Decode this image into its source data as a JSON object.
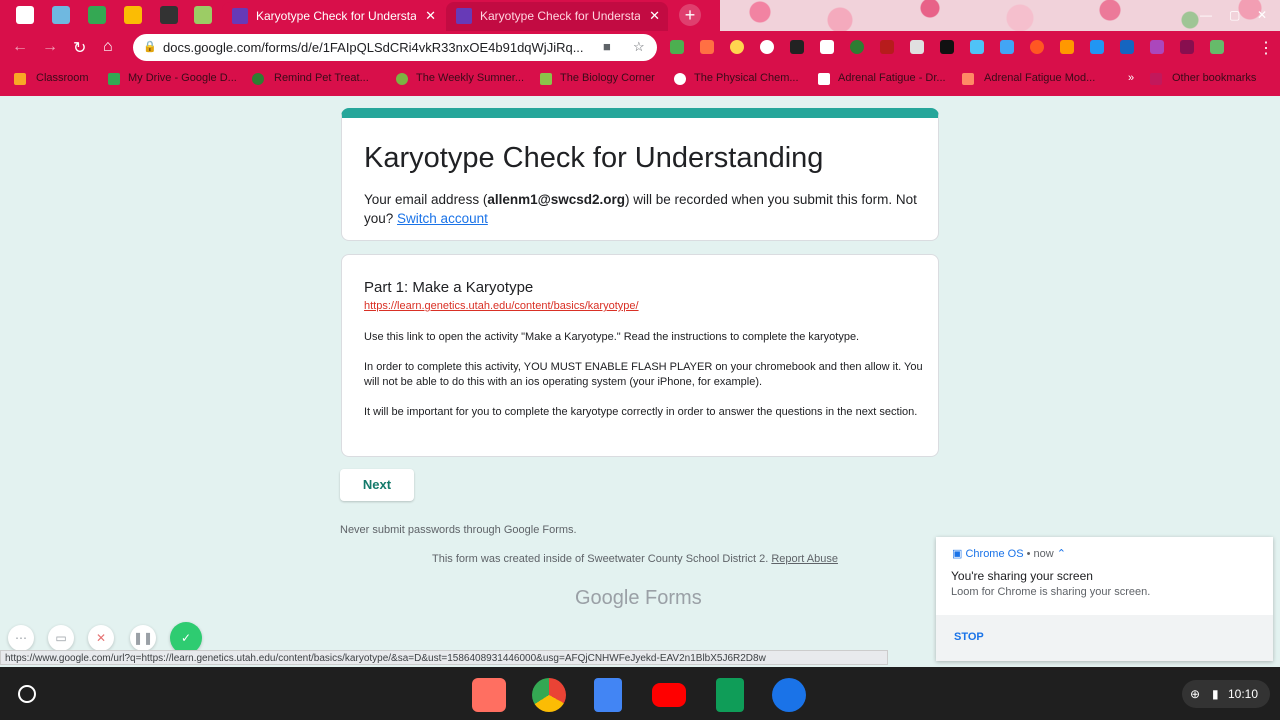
{
  "browser": {
    "active_tab_title": "Karyotype Check for Understanding",
    "second_tab_title": "Karyotype Check for Understanding",
    "url": "docs.google.com/forms/d/e/1FAIpQLSdCRi4vkR33nxOE4b91dqWjJiRq...",
    "new_tab": "+",
    "status_url": "https://www.google.com/url?q=https://learn.genetics.utah.edu/content/basics/karyotype/&sa=D&ust=1586408931446000&usg=AFQjCNHWFeJyekd-EAV2n1BlbX5J6R2D8w",
    "bookmarks": [
      "Classroom",
      "My Drive - Google D...",
      "Remind Pet Treat...",
      "The Weekly Sumner...",
      "The Biology Corner",
      "The Physical Chem...",
      "Adrenal Fatigue - Dr...",
      "Adrenal Fatigue Mod...",
      "Other bookmarks"
    ]
  },
  "form": {
    "title": "Karyotype Check for Understanding",
    "email_prefix": "Your email address (",
    "email": "allenm1@swcsd2.org",
    "email_suffix": ") will be recorded when you submit this form. Not you?",
    "switch_account": "Switch account",
    "section_title": "Part 1: Make a Karyotype",
    "section_link": "https://learn.genetics.utah.edu/content/basics/karyotype/",
    "para1": "Use this link to open the activity \"Make a Karyotype.\" Read the instructions to complete the karyotype.",
    "para2": "In order to complete this activity, YOU MUST ENABLE FLASH PLAYER on your chromebook and then allow it.  You will not be able to do this with an ios operating system (your iPhone, for example).",
    "para3": "It will be important for you to complete the karyotype correctly in order to answer the questions in the next section.",
    "next_button": "Next",
    "never_submit": "Never submit passwords through Google Forms.",
    "created_inside": "This form was created inside of Sweetwater County School District 2.",
    "report_abuse": "Report Abuse",
    "brand": "Google Forms"
  },
  "notification": {
    "source": "Chrome OS",
    "time": "now",
    "title": "You're sharing your screen",
    "body": "Loom for Chrome is sharing your screen.",
    "action": "STOP"
  },
  "shelf": {
    "time": "10:10"
  },
  "colors": {
    "chrome_frame": "#d80f4a",
    "form_accent": "#26a69a",
    "page_bg": "#e3f2f0"
  }
}
